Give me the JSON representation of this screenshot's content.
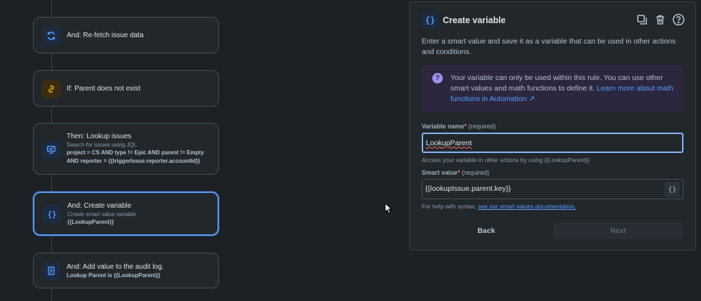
{
  "flow": {
    "steps": [
      {
        "title": "And: Re-fetch issue data",
        "icon": "refresh-icon"
      },
      {
        "title": "If: Parent does not exist",
        "icon": "link-icon"
      },
      {
        "title": "Then: Lookup issues",
        "subtitle": "Search for issues using JQL",
        "detail1": "project = CS AND type != Epic AND parent != Empty",
        "detail2": "AND reporter = {{triggerIssue.reporter.accountId}}",
        "icon": "monitor-icon"
      },
      {
        "title": "And: Create variable",
        "subtitle": "Create smart value variable",
        "detail1": "{{LookupParent}}",
        "icon": "braces-icon"
      },
      {
        "title": "And: Add value to the audit log.",
        "detail1": "Lookup Parent is {{LookupParent}}",
        "icon": "document-icon"
      }
    ]
  },
  "panel": {
    "title": "Create variable",
    "header_icon": "{}",
    "description": "Enter a smart value and save it as a variable that can be used in other actions and conditions.",
    "info_text": "Your variable can only be used within this rule. You can use other smart values and math functions to define it.",
    "info_link": "Learn more about math functions in Automation ↗",
    "variable_name_label": "Variable name",
    "smart_value_label": "Smart value",
    "required_marker": "*",
    "required_text": "(required)",
    "variable_name_value": "LookupParent",
    "variable_help": "Access your variable in other actions by using {{LookupParent}}",
    "smart_value_value": "{{lookupIssue.parent.key}}",
    "brace_button": "{}",
    "syntax_help_prefix": "For help with syntax,",
    "syntax_help_link": "see our smart values documentation.",
    "back_label": "Back",
    "next_label": "Next"
  },
  "colors": {
    "background": "#1d2125",
    "accent": "#579dff",
    "selected_border": "#579dff",
    "info_bg": "#2b273f"
  }
}
